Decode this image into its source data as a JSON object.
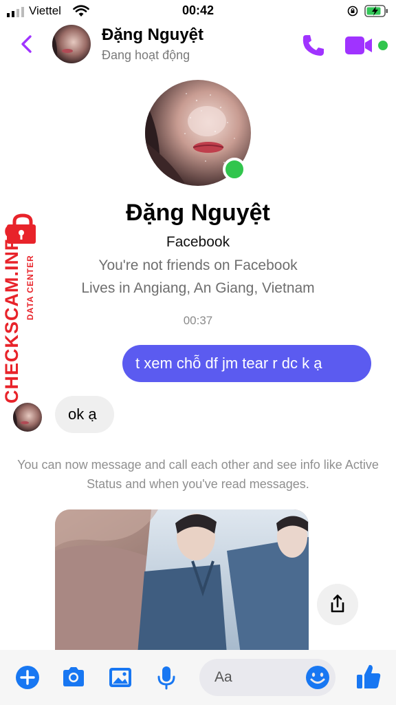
{
  "status_bar": {
    "carrier": "Viettel",
    "time": "00:42"
  },
  "header": {
    "name": "Đặng Nguyệt",
    "status": "Đang hoạt động"
  },
  "profile": {
    "name": "Đặng Nguyệt",
    "source": "Facebook",
    "friendship": "You're not friends on Facebook",
    "location": "Lives in Angiang, An Giang, Vietnam"
  },
  "conversation": {
    "timestamp": "00:37",
    "messages": [
      {
        "direction": "outgoing",
        "text": "t xem chỗ df jm tear r dc k ạ"
      },
      {
        "direction": "incoming",
        "text": "ok ạ"
      }
    ],
    "info": "You can now message and call each other and see info like Active Status and when you've read messages."
  },
  "watermark": {
    "main": "CHECKSCAM.INFO",
    "sub": "DATA CENTER"
  },
  "composer": {
    "placeholder": "Aa"
  },
  "colors": {
    "accent": "#a033ff",
    "outgoing_bubble": "#5b5bf0",
    "online": "#31c54d",
    "composer_icon": "#1877f2",
    "watermark": "#e8232a"
  }
}
